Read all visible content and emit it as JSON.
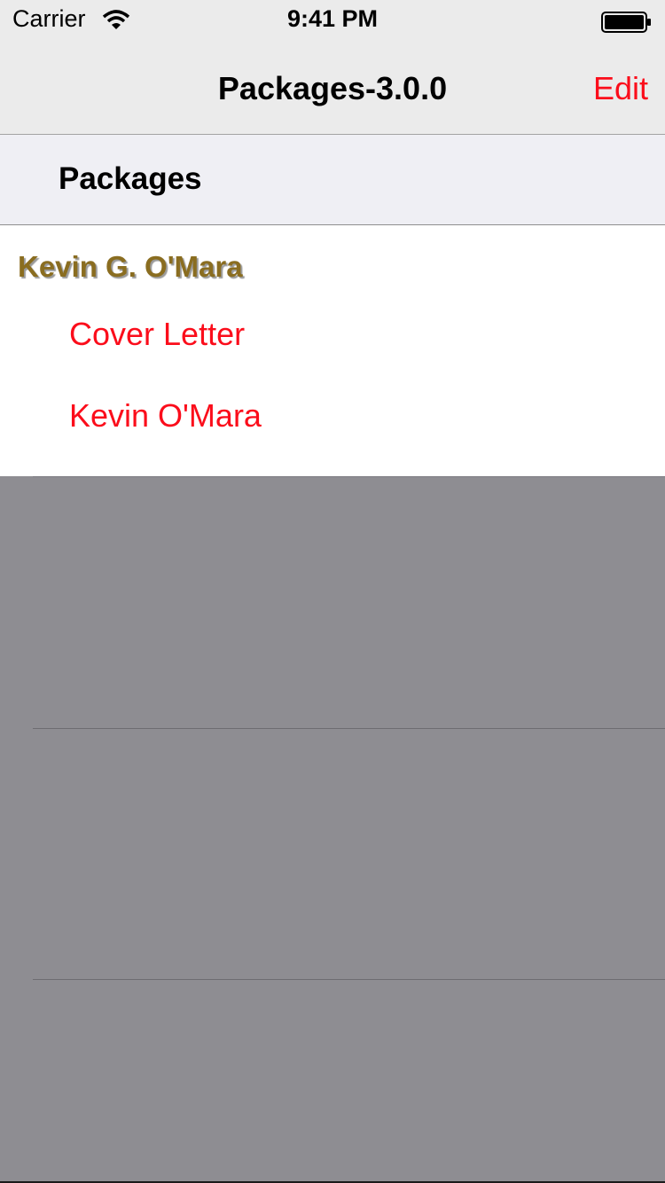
{
  "status_bar": {
    "carrier": "Carrier",
    "time": "9:41 PM"
  },
  "nav_bar": {
    "title": "Packages-3.0.0",
    "edit_label": "Edit"
  },
  "section": {
    "title": "Packages"
  },
  "package": {
    "owner_name": "Kevin G. O'Mara",
    "items": [
      {
        "label": "Cover Letter"
      },
      {
        "label": "Kevin O'Mara"
      }
    ]
  },
  "colors": {
    "accent": "#fb0d1b",
    "owner_name": "#8a6d20",
    "empty_area": "#8e8d92",
    "chrome": "#ebebeb"
  }
}
